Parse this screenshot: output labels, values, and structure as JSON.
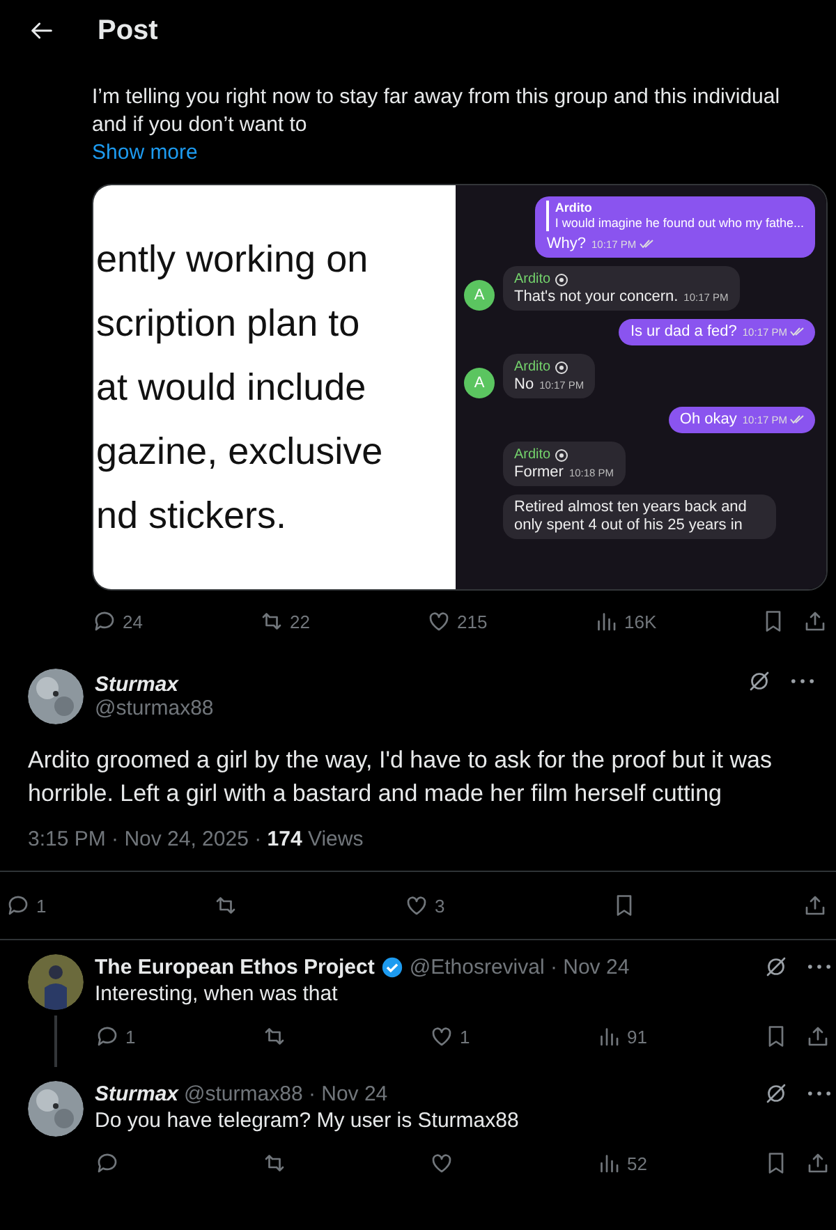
{
  "header": {
    "title": "Post"
  },
  "parent_post": {
    "text": "I’m telling you right now to stay far away from this group and this individual and if you don’t want to",
    "show_more": "Show more",
    "media": {
      "document_lines": [
        "ently working on",
        "scription plan to",
        "at would include",
        "gazine, exclusive",
        "nd stickers."
      ],
      "chat": [
        {
          "kind": "outgoing",
          "quote": {
            "sender": "Ardito",
            "text": "I would imagine he found out who my fathe..."
          },
          "text": "Why?",
          "time": "10:17 PM",
          "read": true
        },
        {
          "kind": "incoming",
          "sender": "Ardito",
          "avatar": "A",
          "text": "That's not your concern.",
          "time": "10:17 PM"
        },
        {
          "kind": "outgoing",
          "text": "Is ur dad a fed?",
          "time": "10:17 PM",
          "read": true
        },
        {
          "kind": "incoming",
          "sender": "Ardito",
          "avatar": "A",
          "text": "No",
          "time": "10:17 PM"
        },
        {
          "kind": "outgoing",
          "text": "Oh okay",
          "time": "10:17 PM",
          "read": true
        },
        {
          "kind": "incoming",
          "sender": "Ardito",
          "text": "Former",
          "time": "10:18 PM"
        },
        {
          "kind": "incoming",
          "text": "Retired almost ten years back and only spent 4 out of his 25 years in"
        }
      ]
    },
    "actions": {
      "replies": "24",
      "reposts": "22",
      "likes": "215",
      "views": "16K"
    }
  },
  "main_post": {
    "name": "Sturmax",
    "italic": true,
    "handle": "@sturmax88",
    "text": "Ardito groomed a girl by the way, I'd have to ask for the proof but it was horrible. Left a girl with a bastard and made her film herself cutting",
    "time": "3:15 PM · Nov 24, 2025 ·",
    "views_count": "174",
    "views_label": "Views",
    "actions": {
      "replies": "1",
      "likes": "3"
    }
  },
  "replies": [
    {
      "name": "The European Ethos Project",
      "italic": false,
      "verified": true,
      "handle": "@Ethosrevival · Nov 24",
      "text": "Interesting, when was that",
      "actions": {
        "replies": "1",
        "likes": "1",
        "views": "91"
      }
    },
    {
      "name": "Sturmax",
      "italic": true,
      "verified": false,
      "handle": "@sturmax88 · Nov 24",
      "text": "Do you have telegram? My user is Sturmax88",
      "actions": {
        "views": "52"
      }
    }
  ]
}
